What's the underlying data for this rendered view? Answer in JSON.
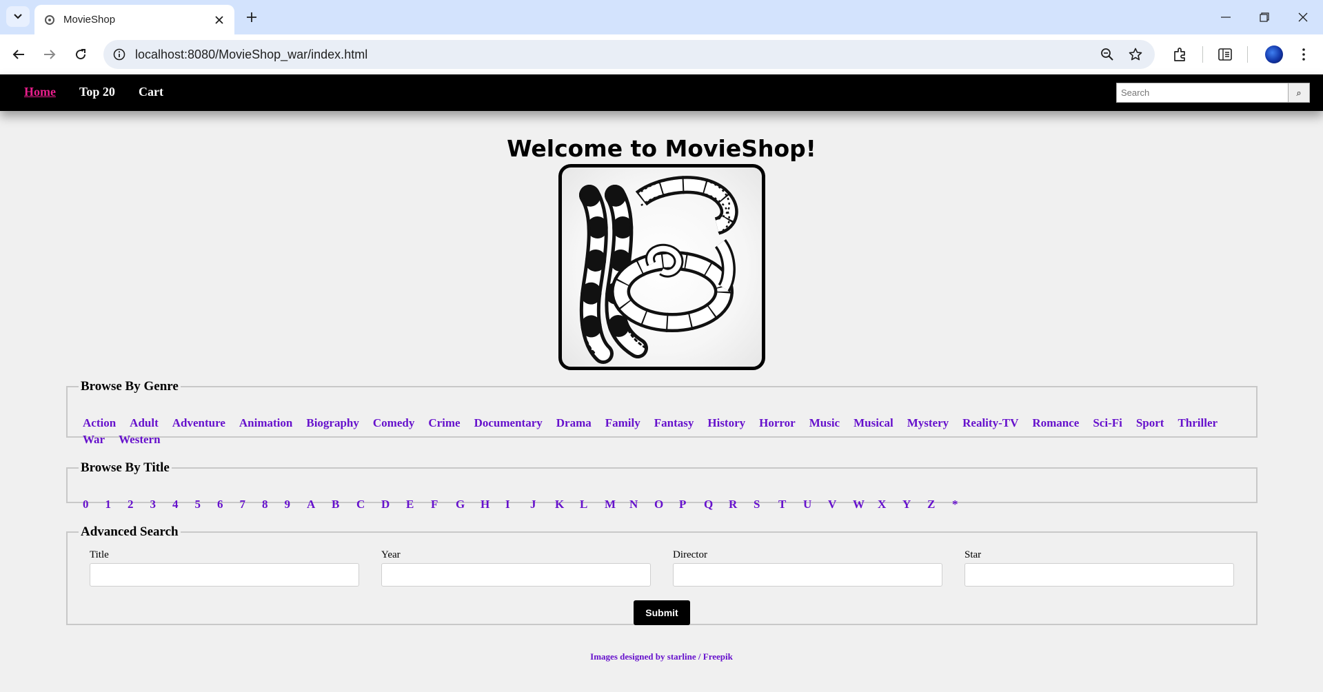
{
  "browser": {
    "tab_title": "MovieShop",
    "url": "localhost:8080/MovieShop_war/index.html"
  },
  "nav": {
    "items": [
      {
        "label": "Home",
        "active": true
      },
      {
        "label": "Top 20",
        "active": false
      },
      {
        "label": "Cart",
        "active": false
      }
    ],
    "search_placeholder": "Search",
    "search_button": "⌕"
  },
  "main": {
    "heading": "Welcome to MovieShop!"
  },
  "genre": {
    "legend": "Browse By Genre",
    "items": [
      "Action",
      "Adult",
      "Adventure",
      "Animation",
      "Biography",
      "Comedy",
      "Crime",
      "Documentary",
      "Drama",
      "Family",
      "Fantasy",
      "History",
      "Horror",
      "Music",
      "Musical",
      "Mystery",
      "Reality-TV",
      "Romance",
      "Sci-Fi",
      "Sport",
      "Thriller",
      "War",
      "Western"
    ]
  },
  "title_browse": {
    "legend": "Browse By Title",
    "items": [
      "0",
      "1",
      "2",
      "3",
      "4",
      "5",
      "6",
      "7",
      "8",
      "9",
      "A",
      "B",
      "C",
      "D",
      "E",
      "F",
      "G",
      "H",
      "I",
      "J",
      "K",
      "L",
      "M",
      "N",
      "O",
      "P",
      "Q",
      "R",
      "S",
      "T",
      "U",
      "V",
      "W",
      "X",
      "Y",
      "Z",
      "*"
    ]
  },
  "advanced": {
    "legend": "Advanced Search",
    "fields": [
      {
        "label": "Title",
        "value": ""
      },
      {
        "label": "Year",
        "value": ""
      },
      {
        "label": "Director",
        "value": ""
      },
      {
        "label": "Star",
        "value": ""
      }
    ],
    "submit_label": "Submit"
  },
  "footer": {
    "credit": "Images designed by starline / Freepik"
  },
  "colors": {
    "nav_bg": "#000000",
    "nav_active": "#e91e8c",
    "link": "#6611cc",
    "page_bg": "#f0f0f0"
  },
  "icons": [
    "tab-search-icon",
    "favicon-icon",
    "close-icon",
    "plus-icon",
    "minimize-icon",
    "restore-icon",
    "close-window-icon",
    "back-icon",
    "forward-icon",
    "reload-icon",
    "info-icon",
    "zoom-icon",
    "bookmark-star-icon",
    "extensions-icon",
    "reading-list-icon",
    "more-menu-icon",
    "film-reel-logo"
  ]
}
